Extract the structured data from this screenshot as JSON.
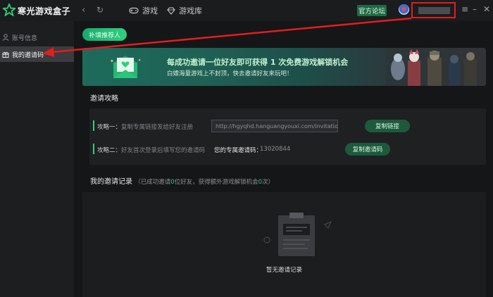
{
  "app": {
    "title": "寒光游戏盒子",
    "logo_icon": "star-logo-icon"
  },
  "nav": {
    "back_icon": "chevron-left-icon",
    "refresh_icon": "refresh-icon",
    "games_label": "游戏",
    "library_label": "游戏库",
    "forum_label": "官方论坛"
  },
  "colors": {
    "accent": "#2fcf7a",
    "highlight_box": "#e01e1e"
  },
  "sidebar": {
    "items": [
      {
        "label": "账号信息",
        "icon": "user-icon",
        "active": false
      },
      {
        "label": "我的邀请码",
        "icon": "gift-icon",
        "active": true
      }
    ]
  },
  "main": {
    "recommend_label": "补填推荐人",
    "banner": {
      "headline": "每成功邀请一位好友即可获得 1 次免费游戏解锁机会",
      "subline": "白嫖海量游戏上不封顶，快去邀请好友来玩吧！"
    },
    "strategy": {
      "title": "邀请攻略",
      "step1_prefix": "攻略一：",
      "step1_text": "复制专属链接发给好友注册",
      "link_value": "http://hgyqhd.hanguangyouxi.com/invitation!",
      "copy_link_label": "复制链接",
      "step2_prefix": "攻略二：",
      "step2_text": "好友首次登录后填写您的邀请码",
      "code_label": "您的专属邀请码：",
      "code_value": "13020844",
      "copy_code_label": "复制邀请码"
    },
    "records": {
      "title": "我的邀请记录",
      "summary_pre": "（已成功邀请",
      "invited_count": "0",
      "summary_mid": "位好友，获得额外游戏解锁机会",
      "unlock_count": "0",
      "summary_post": "次）",
      "empty_text": "暂无邀请记录"
    }
  }
}
